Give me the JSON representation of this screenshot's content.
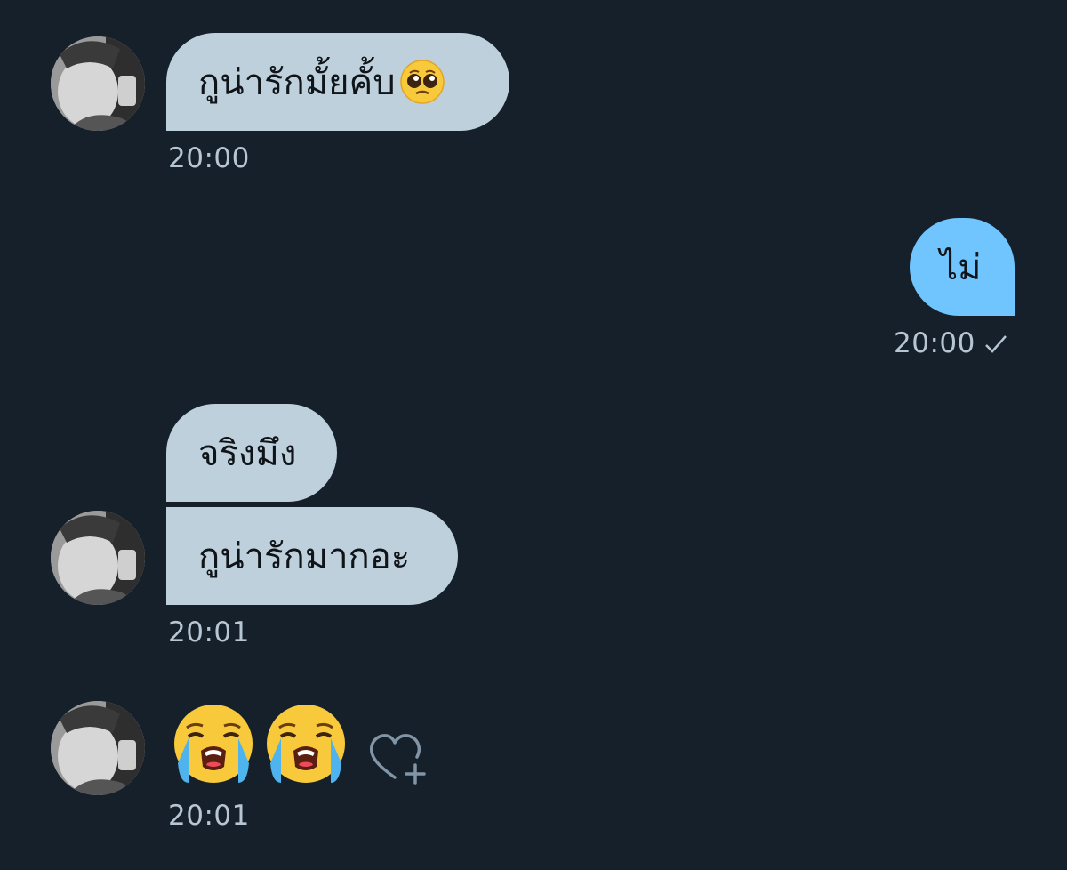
{
  "messages": [
    {
      "text": "กูน่ารักมั้ยคั้บ",
      "emoji": "pleading-face",
      "time": "20:00",
      "from": "them"
    },
    {
      "text": "ไม่",
      "time": "20:00",
      "from": "me"
    },
    {
      "text": "จริงมึง",
      "from": "them"
    },
    {
      "text": "กูน่ารักมากอะ",
      "time": "20:01",
      "from": "them"
    },
    {
      "emoji_only": [
        "loudly-crying-face",
        "loudly-crying-face"
      ],
      "time": "20:01",
      "from": "them"
    }
  ],
  "icons": {
    "sent_check": "check-icon",
    "react": "heart-plus-icon"
  },
  "colors": {
    "background": "#15202b",
    "incoming_bubble": "#bfd0dd",
    "outgoing_bubble": "#70c5ff",
    "timestamp": "#b7c6d3"
  }
}
